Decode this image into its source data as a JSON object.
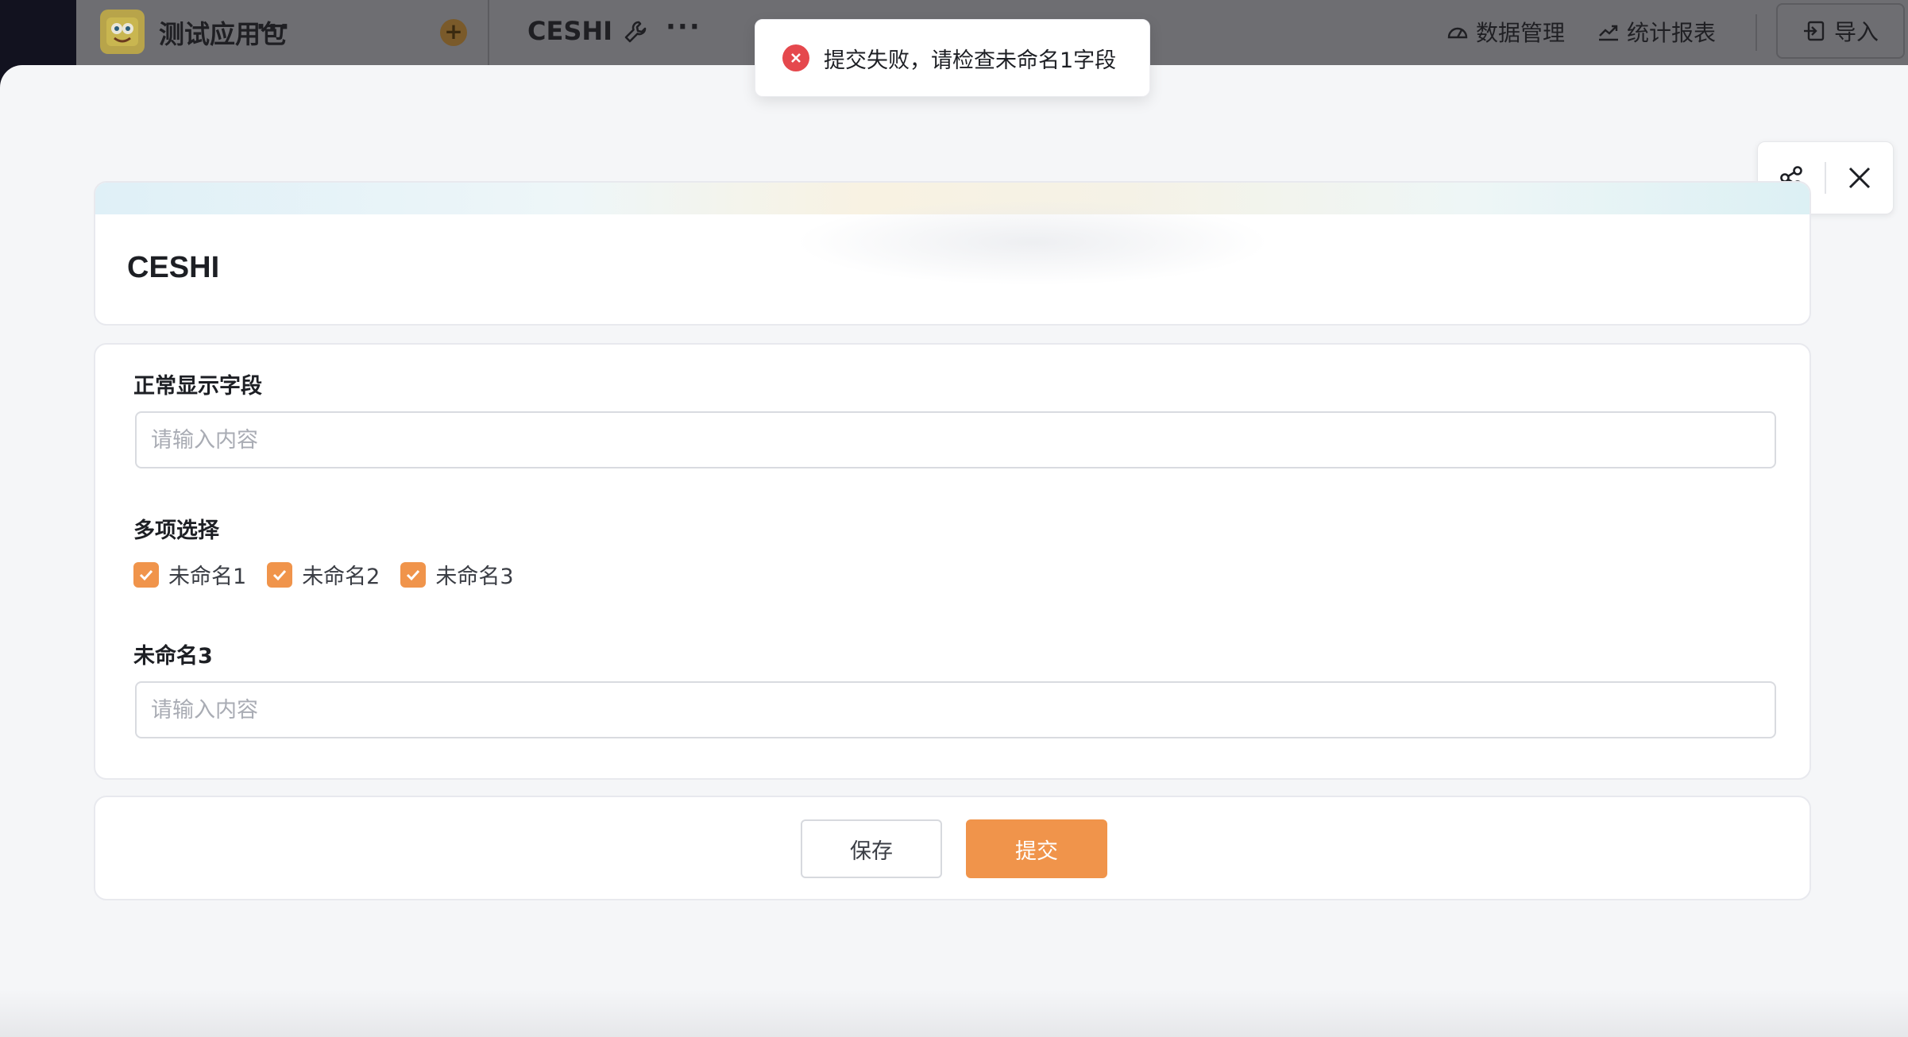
{
  "topbar": {
    "app_name": "测试应用包",
    "more_label": "···",
    "add_label": "+",
    "form_name": "CESHI",
    "form_more_label": "···",
    "nav": {
      "data_manage": "数据管理",
      "stats_report": "统计报表",
      "import": "导入"
    }
  },
  "toast": {
    "type": "error",
    "message": "提交失败，请检查未命名1字段"
  },
  "drawer": {
    "tools": {
      "share_icon": "share-icon",
      "close_icon": "close-icon"
    },
    "title": "CESHI",
    "fields": {
      "normal": {
        "label": "正常显示字段",
        "placeholder": "请输入内容",
        "value": ""
      },
      "multi": {
        "label": "多项选择",
        "options": [
          {
            "label": "未命名1",
            "checked": true
          },
          {
            "label": "未命名2",
            "checked": true
          },
          {
            "label": "未命名3",
            "checked": true
          }
        ]
      },
      "unnamed3": {
        "label": "未命名3",
        "placeholder": "请输入内容",
        "value": ""
      }
    },
    "actions": {
      "save": "保存",
      "submit": "提交"
    }
  },
  "colors": {
    "accent": "#f0944b",
    "error": "#e5484d",
    "overlay_topbar": "#6e6e72"
  }
}
